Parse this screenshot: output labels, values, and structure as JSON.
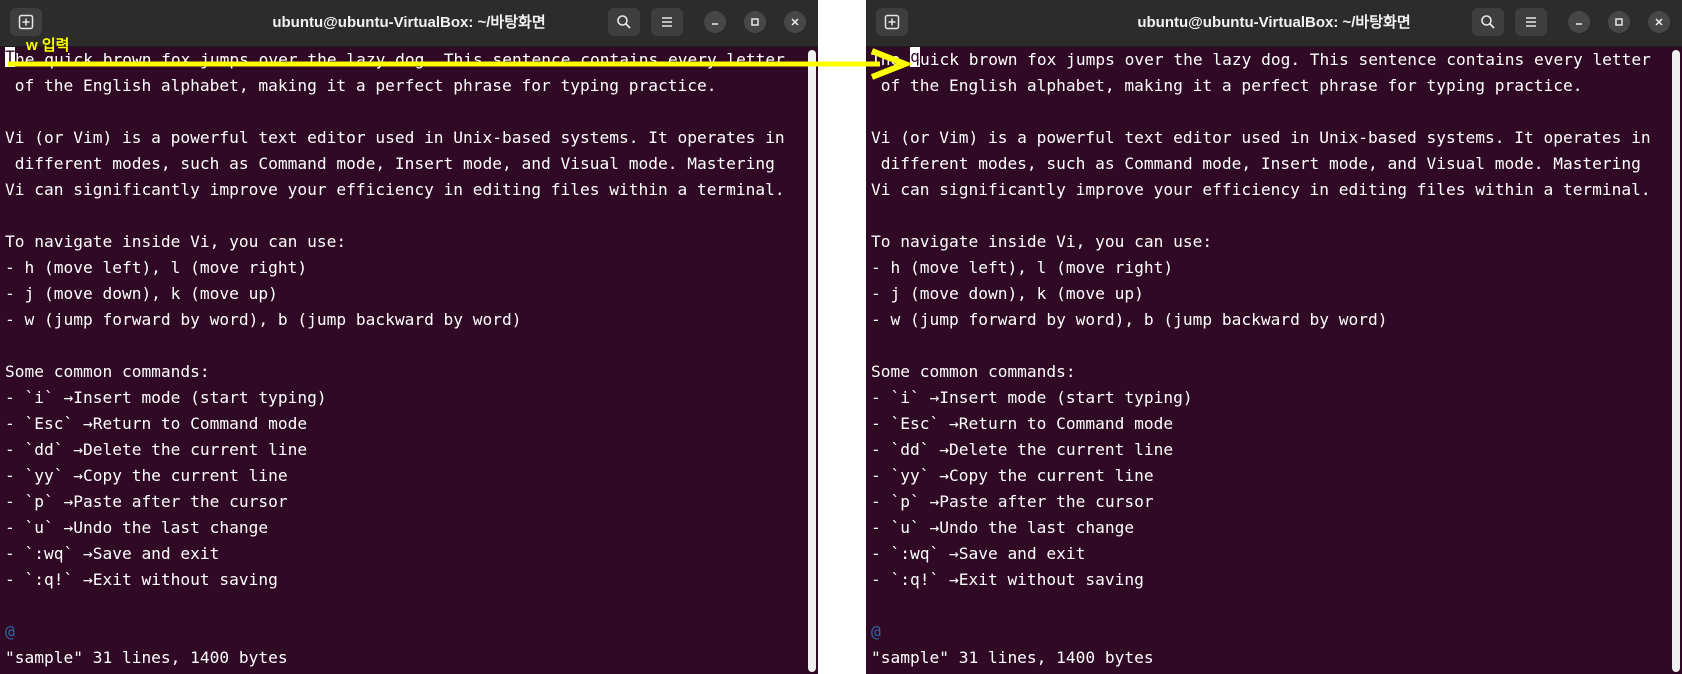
{
  "colors": {
    "terminal_bg": "#300a24",
    "titlebar_bg": "#2c2c2c",
    "text": "#ffffff",
    "annotation": "#ffff00",
    "tilde": "#3465a4"
  },
  "annotation": {
    "label": "w 입력"
  },
  "windows": [
    {
      "title": "ubuntu@ubuntu-VirtualBox: ~/바탕화면",
      "buttons": {
        "new_tab_icon": "new-tab-icon",
        "search_icon": "search-icon",
        "menu_icon": "hamburger-menu-icon",
        "minimize_icon": "minimize-icon",
        "maximize_icon": "maximize-icon",
        "close_icon": "close-icon"
      },
      "cursor": {
        "line": 0,
        "col": 0,
        "char": "T"
      },
      "lines": [
        "The quick brown fox jumps over the lazy dog. This sentence contains every letter",
        " of the English alphabet, making it a perfect phrase for typing practice.",
        "",
        "Vi (or Vim) is a powerful text editor used in Unix-based systems. It operates in",
        " different modes, such as Command mode, Insert mode, and Visual mode. Mastering",
        "Vi can significantly improve your efficiency in editing files within a terminal.",
        "",
        "To navigate inside Vi, you can use:",
        "- h (move left), l (move right)",
        "- j (move down), k (move up)",
        "- w (jump forward by word), b (jump backward by word)",
        "",
        "Some common commands:",
        "- `i` →Insert mode (start typing)",
        "- `Esc` →Return to Command mode",
        "- `dd` →Delete the current line",
        "- `yy` →Copy the current line",
        "- `p` →Paste after the cursor",
        "- `u` →Undo the last change",
        "- `:wq` →Save and exit",
        "- `:q!` →Exit without saving",
        "",
        "@",
        "\"sample\" 31 lines, 1400 bytes"
      ]
    },
    {
      "title": "ubuntu@ubuntu-VirtualBox: ~/바탕화면",
      "buttons": {
        "new_tab_icon": "new-tab-icon",
        "search_icon": "search-icon",
        "menu_icon": "hamburger-menu-icon",
        "minimize_icon": "minimize-icon",
        "maximize_icon": "maximize-icon",
        "close_icon": "close-icon"
      },
      "cursor": {
        "line": 0,
        "col": 4,
        "char": "q"
      },
      "lines": [
        "The quick brown fox jumps over the lazy dog. This sentence contains every letter",
        " of the English alphabet, making it a perfect phrase for typing practice.",
        "",
        "Vi (or Vim) is a powerful text editor used in Unix-based systems. It operates in",
        " different modes, such as Command mode, Insert mode, and Visual mode. Mastering",
        "Vi can significantly improve your efficiency in editing files within a terminal.",
        "",
        "To navigate inside Vi, you can use:",
        "- h (move left), l (move right)",
        "- j (move down), k (move up)",
        "- w (jump forward by word), b (jump backward by word)",
        "",
        "Some common commands:",
        "- `i` →Insert mode (start typing)",
        "- `Esc` →Return to Command mode",
        "- `dd` →Delete the current line",
        "- `yy` →Copy the current line",
        "- `p` →Paste after the cursor",
        "- `u` →Undo the last change",
        "- `:wq` →Save and exit",
        "- `:q!` →Exit without saving",
        "",
        "@",
        "\"sample\" 31 lines, 1400 bytes"
      ]
    }
  ]
}
